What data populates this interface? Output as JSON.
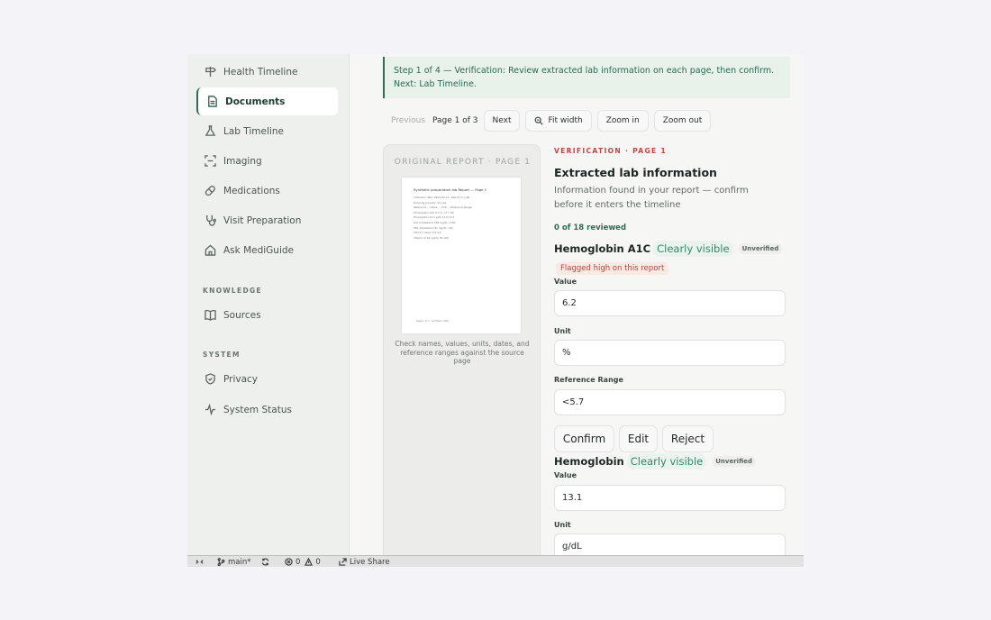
{
  "sidebar": {
    "items": [
      {
        "label": "Health Timeline",
        "icon": "signpost-icon"
      },
      {
        "label": "Documents",
        "icon": "document-icon",
        "active": true
      },
      {
        "label": "Lab Timeline",
        "icon": "flask-icon"
      },
      {
        "label": "Imaging",
        "icon": "scan-icon"
      },
      {
        "label": "Medications",
        "icon": "pill-icon"
      },
      {
        "label": "Visit Preparation",
        "icon": "stethoscope-icon"
      },
      {
        "label": "Ask MediGuide",
        "icon": "home-icon"
      }
    ],
    "knowledge_label": "KNOWLEDGE",
    "knowledge_items": [
      {
        "label": "Sources",
        "icon": "book-icon"
      }
    ],
    "system_label": "SYSTEM",
    "system_items": [
      {
        "label": "Privacy",
        "icon": "shield-icon"
      },
      {
        "label": "System Status",
        "icon": "activity-icon"
      }
    ]
  },
  "banner": {
    "text": "Step 1 of 4 — Verification: Review extracted lab information on each page, then confirm. Next: Lab Timeline."
  },
  "toolbar": {
    "previous": "Previous",
    "page_indicator": "Page 1 of 3",
    "next": "Next",
    "fit_width": "Fit width",
    "zoom_in": "Zoom in",
    "zoom_out": "Zoom out"
  },
  "preview": {
    "label": "ORIGINAL REPORT · PAGE 1",
    "paper_title": "Synthetic preparation lab Report — Page 1",
    "paper_lines": [
      "Collection date: 2024-03-14 · Report id: LAB-",
      "Ordering provider: Dr. Lee",
      "Reference — Value — Unit — Reference Range",
      "Hemoglobin A1C 6.2 % <5.7 (H)",
      "Hemoglobin 13.1 g/dL 12.0-15.5",
      "LDL Cholesterol 128 mg/dL <100",
      "HDL Cholesterol 52 mg/dL >40",
      "TSH 2.1 mIU/L 0.4-4.0",
      "Vitamin D 24 ng/mL 30-100"
    ],
    "paper_footer": "Page 1 of 3 · Synthetic data",
    "hint": "Check names, values, units, dates, and reference ranges against the source page"
  },
  "verification": {
    "kicker": "VERIFICATION · PAGE 1",
    "title": "Extracted lab information",
    "subtitle": "Information found in your report — confirm before it enters the timeline",
    "count": "0 of 18 reviewed",
    "value_label": "Value",
    "unit_label": "Unit",
    "range_label": "Reference Range",
    "items": [
      {
        "name": "Hemoglobin A1C",
        "clarity": "Clearly visible",
        "status": "Unverified",
        "flag": "Flagged high on this report",
        "value": "6.2",
        "unit": "%",
        "range": "<5.7"
      },
      {
        "name": "Hemoglobin",
        "clarity": "Clearly visible",
        "status": "Unverified",
        "value": "13.1",
        "unit": "g/dL"
      }
    ],
    "actions": {
      "confirm": "Confirm",
      "edit": "Edit",
      "reject": "Reject"
    }
  },
  "statusbar": {
    "branch": "main*",
    "errors": "0",
    "warnings": "0",
    "live_share": "Live Share"
  }
}
